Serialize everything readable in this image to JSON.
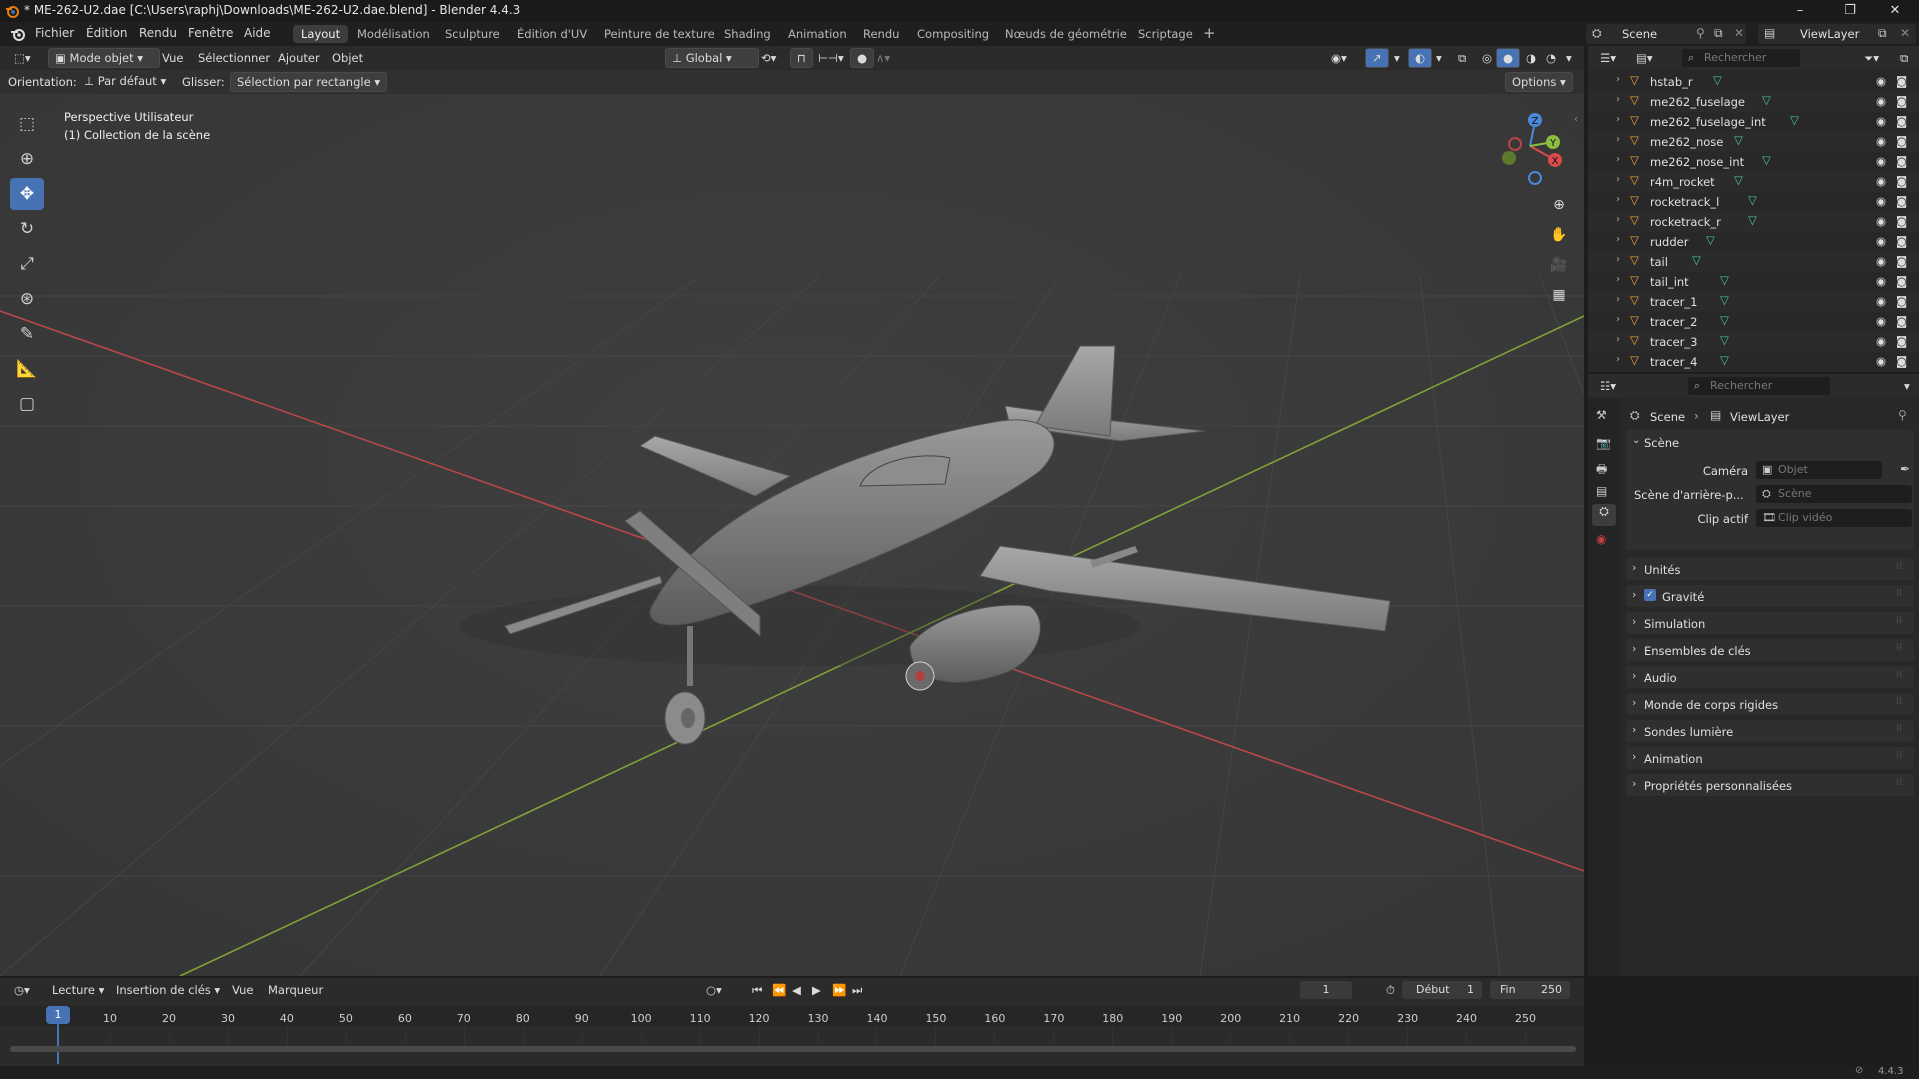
{
  "window": {
    "title": "* ME-262-U2.dae [C:\\Users\\raphj\\Downloads\\ME-262-U2.dae.blend] - Blender 4.4.3"
  },
  "menu": {
    "items": [
      "Fichier",
      "Édition",
      "Rendu",
      "Fenêtre",
      "Aide"
    ]
  },
  "workspaces": [
    "Layout",
    "Modélisation",
    "Sculpture",
    "Édition d'UV",
    "Peinture de texture",
    "Shading",
    "Animation",
    "Rendu",
    "Compositing",
    "Nœuds de géométrie",
    "Scriptage"
  ],
  "topbar": {
    "scene": "Scene",
    "viewlayer": "ViewLayer"
  },
  "viewport_header": {
    "mode": "Mode objet",
    "vue": "Vue",
    "select": "Sélectionner",
    "add": "Ajouter",
    "object": "Objet",
    "transform": "Global"
  },
  "tool_header": {
    "orientation_label": "Orientation:",
    "orientation_value": "Par défaut",
    "drag_label": "Glisser:",
    "drag_value": "Sélection par rectangle",
    "options": "Options"
  },
  "viewport": {
    "view_name": "Perspective Utilisateur",
    "collection": "(1) Collection de la scène"
  },
  "gizmo": {
    "x": "X",
    "y": "Y",
    "z": "Z"
  },
  "outliner": {
    "search_placeholder": "Rechercher",
    "items": [
      "hstab_r",
      "me262_fuselage",
      "me262_fuselage_int",
      "me262_nose",
      "me262_nose_int",
      "r4m_rocket",
      "rocketrack_l",
      "rocketrack_r",
      "rudder",
      "tail",
      "tail_int",
      "tracer_1",
      "tracer_2",
      "tracer_3",
      "tracer_4"
    ]
  },
  "properties": {
    "search_placeholder": "Rechercher",
    "breadcrumb_scene": "Scene",
    "breadcrumb_viewlayer": "ViewLayer",
    "section": "Scène",
    "camera_label": "Caméra",
    "camera_placeholder": "Objet",
    "bg_scene_label": "Scène d'arrière-p...",
    "bg_scene_placeholder": "Scène",
    "clip_label": "Clip actif",
    "clip_placeholder": "Clip vidéo",
    "panels": [
      "Unités",
      "Gravité",
      "Simulation",
      "Ensembles de clés",
      "Audio",
      "Monde de corps rigides",
      "Sondes lumière",
      "Animation",
      "Propriétés personnalisées"
    ]
  },
  "timeline": {
    "playback": "Lecture",
    "keying": "Insertion de clés",
    "view": "Vue",
    "marker": "Marqueur",
    "current_frame": "1",
    "start_label": "Début",
    "start": "1",
    "end_label": "Fin",
    "end": "250",
    "ticks": [
      "1",
      "10",
      "20",
      "30",
      "40",
      "50",
      "60",
      "70",
      "80",
      "90",
      "100",
      "110",
      "120",
      "130",
      "140",
      "150",
      "160",
      "170",
      "180",
      "190",
      "200",
      "210",
      "220",
      "230",
      "240",
      "250"
    ]
  },
  "status": {
    "version": "4.4.3"
  },
  "colors": {
    "accent": "#4772b3",
    "mesh_icon": "#f0a040",
    "mesh_data": "#44c0a0",
    "x_axis": "#d94c4c",
    "y_axis": "#8cbf3f",
    "z_axis": "#4a88d8"
  }
}
